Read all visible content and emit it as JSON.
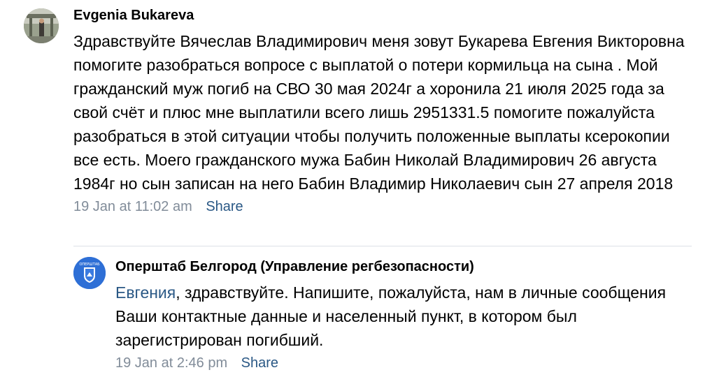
{
  "comment": {
    "author": "Evgenia Bukareva",
    "text": "Здравствуйте Вячеслав Владимирович меня зовут Букарева Евгения Викторовна помогите разобраться вопросе с выплатой о потери кормильца на сына . Мой гражданский муж погиб на СВО 30 мая 2024г а хоронила 21 июля 2025 года за свой счёт и плюс мне выплатили всего лишь 2951331.5 помогите пожалуйста разобраться в этой ситуации чтобы получить положенные выплаты ксерокопии все есть. Моего гражданского мужа Бабин Николай Владимирович 26 августа 1984г но сын записан на него Бабин Владимир Николаевич сын 27 апреля 2018",
    "timestamp": "19 Jan at 11:02 am",
    "share_label": "Share"
  },
  "reply": {
    "author": "Оперштаб Белгород (Управление регбезопасности)",
    "mention": "Евгения",
    "text": ", здравствуйте. Напишите, пожалуйста, нам в личные сообщения Ваши контактные данные и населенный пункт, в котором был зарегистрирован погибший.",
    "timestamp": "19 Jan at 2:46 pm",
    "share_label": "Share",
    "avatar_text": "ОПЕРШТАБ"
  },
  "colors": {
    "link": "#2a5885",
    "meta": "#818c99",
    "divider": "#dce1e6",
    "reply_avatar_bg": "#2e6fd6"
  }
}
